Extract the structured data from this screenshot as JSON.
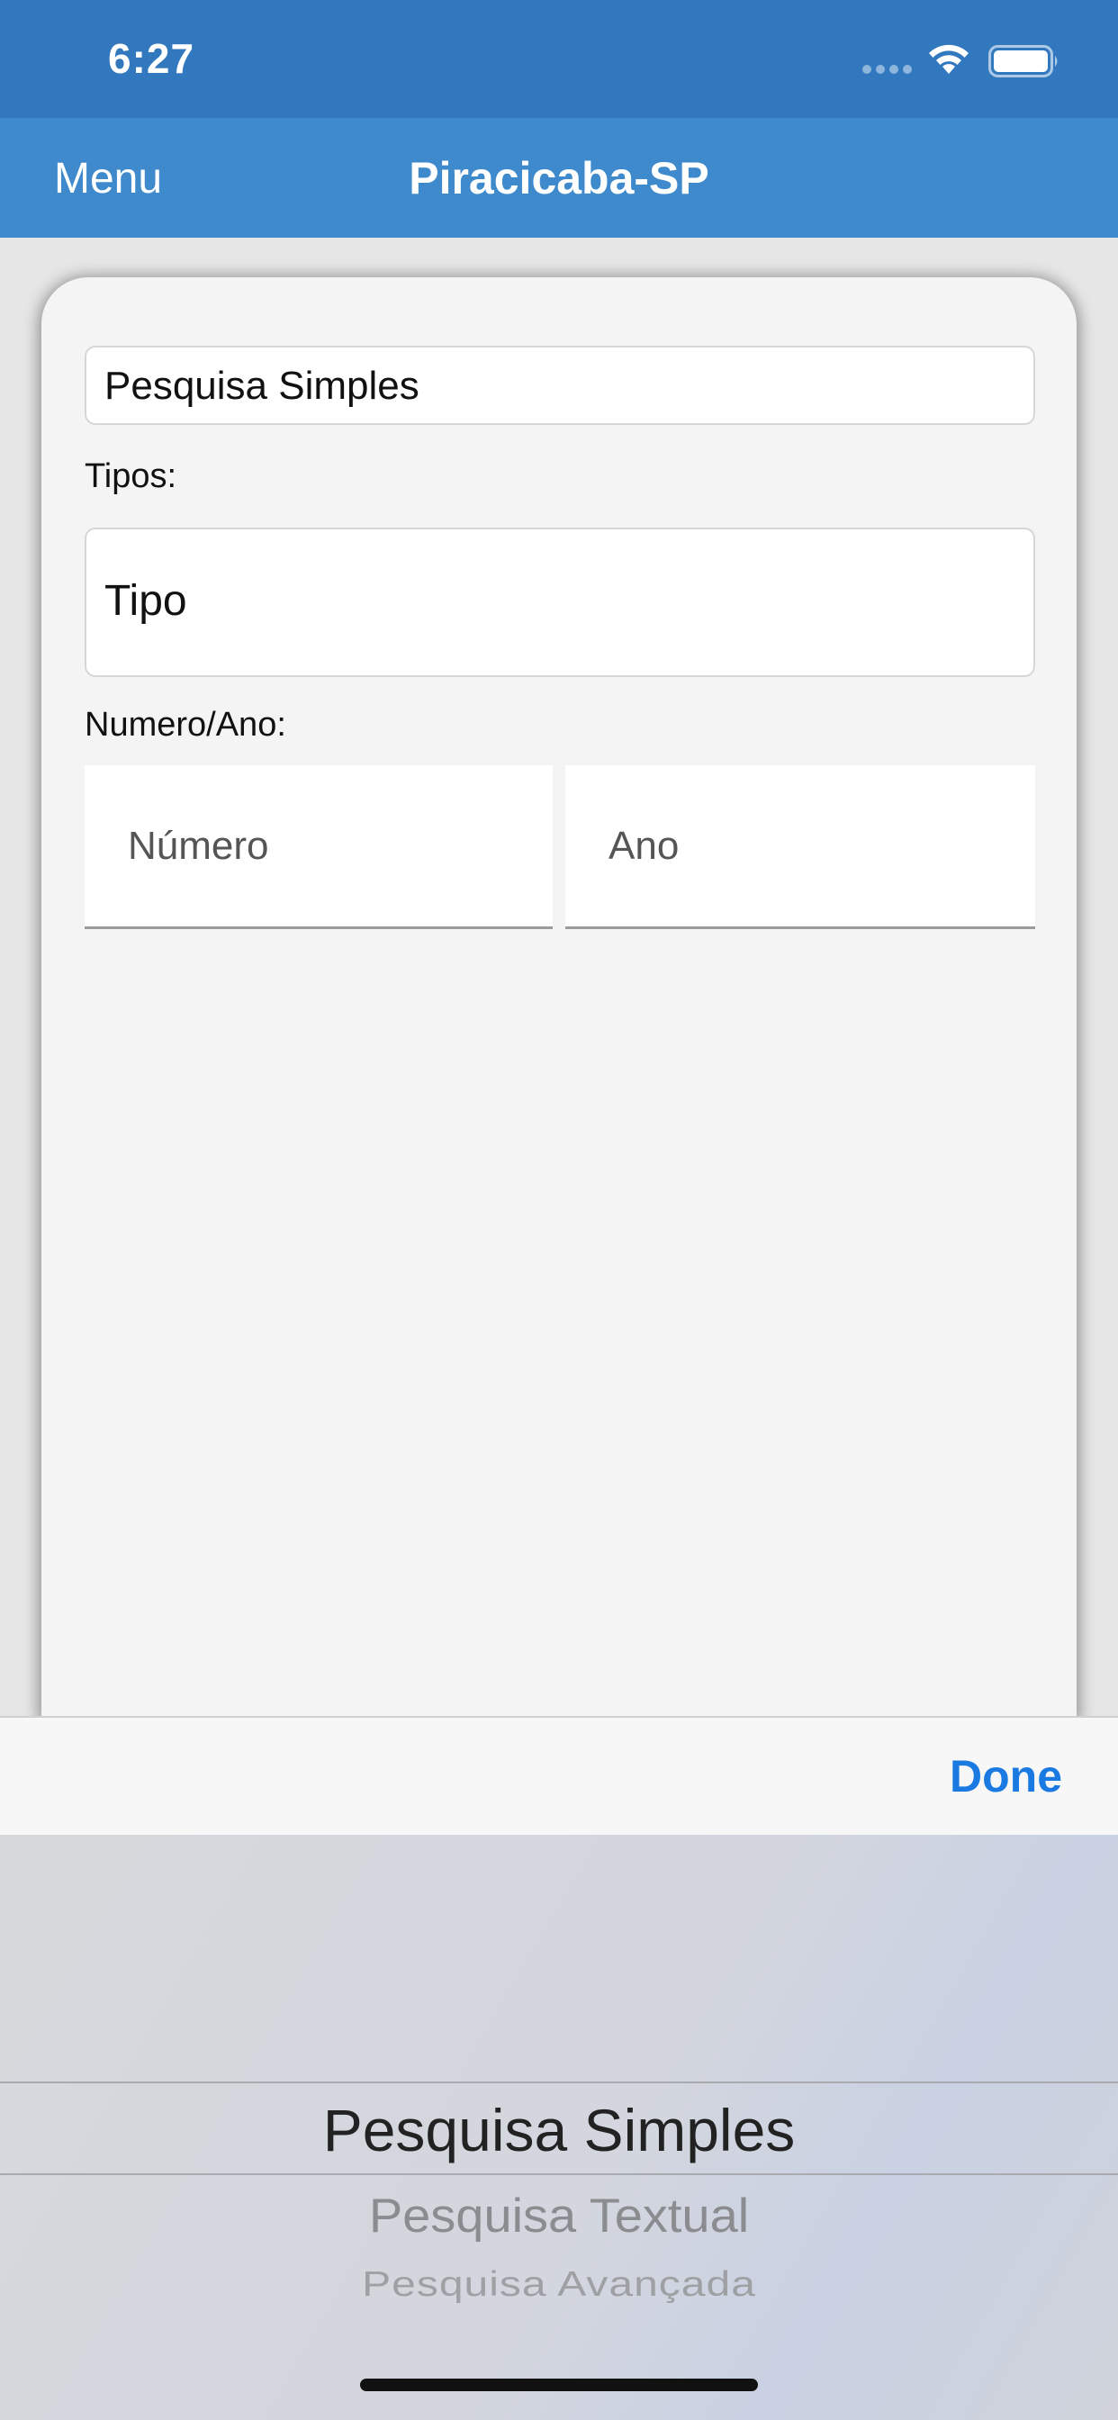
{
  "status_bar": {
    "time": "6:27",
    "icons": [
      "signal-dots-icon",
      "wifi-icon",
      "battery-icon"
    ]
  },
  "nav": {
    "menu_label": "Menu",
    "title": "Piracicaba-SP"
  },
  "form": {
    "search_mode_value": "Pesquisa Simples",
    "tipos_label": "Tipos:",
    "tipo_value": "Tipo",
    "numero_ano_label": "Numero/Ano:",
    "numero_placeholder": "Número",
    "ano_placeholder": "Ano"
  },
  "toolbar": {
    "done_label": "Done"
  },
  "picker": {
    "options": [
      "Pesquisa Simples",
      "Pesquisa Textual",
      "Pesquisa Avançada"
    ],
    "selected": "Pesquisa Simples"
  },
  "colors": {
    "status_bar": "#3278be",
    "nav_bar": "#3e8acc",
    "accent": "#1a7ae2"
  }
}
